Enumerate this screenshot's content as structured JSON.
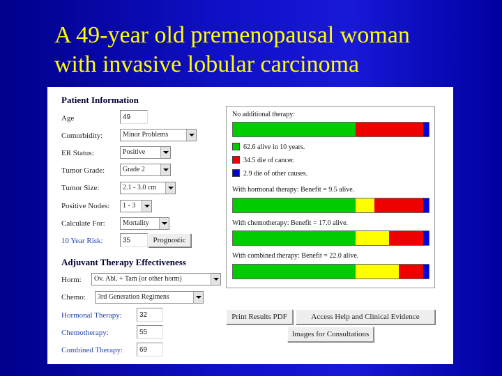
{
  "slide": {
    "title_line1": "A 49-year old premenopausal woman",
    "title_line2": "with invasive lobular carcinoma"
  },
  "colors": {
    "alive": "#00cc00",
    "cancer": "#ee0000",
    "other": "#0000dd",
    "benefit": "#ffff00"
  },
  "patient": {
    "heading": "Patient Information",
    "age_label": "Age",
    "age_value": "49",
    "comorbidity_label": "Comorbidity:",
    "comorbidity_value": "Minor Problems",
    "er_label": "ER Status:",
    "er_value": "Positive",
    "grade_label": "Tumor Grade:",
    "grade_value": "Grade 2",
    "size_label": "Tumor Size:",
    "size_value": "2.1 - 3.0 cm",
    "nodes_label": "Positive Nodes:",
    "nodes_value": "1 - 3",
    "calc_label": "Calculate For:",
    "calc_value": "Mortality",
    "risk_label": "10 Year Risk:",
    "risk_value": "35",
    "prognostic_button": "Prognostic"
  },
  "adjuvant": {
    "heading": "Adjuvant Therapy Effectiveness",
    "horm_label": "Horm:",
    "horm_value": "Ov. Abl. + Tam (or other horm)",
    "chemo_label": "Chemo:",
    "chemo_value": "3rd Generation Regimens",
    "hormonal_label": "Hormonal Therapy:",
    "hormonal_value": "32",
    "chemotherapy_label": "Chemotherapy:",
    "chemotherapy_value": "55",
    "combined_label": "Combined Therapy:",
    "combined_value": "69"
  },
  "results": {
    "no_therapy_label": "No additional therapy:",
    "legend_alive": "62.6 alive in 10 years.",
    "legend_cancer": "34.5 die of cancer.",
    "legend_other": "2.9 die of other causes.",
    "hormonal_label": "With hormonal therapy:  Benefit = 9.5 alive.",
    "chemo_label": "With chemotherapy:  Benefit = 17.0 alive.",
    "combined_label": "With combined therapy:  Benefit = 22.0 alive.",
    "bars": {
      "none": {
        "alive": 62.6,
        "benefit": 0,
        "cancer": 34.5,
        "other": 2.9
      },
      "hormonal": {
        "alive": 62.6,
        "benefit": 9.5,
        "cancer": 25.0,
        "other": 2.9
      },
      "chemo": {
        "alive": 62.6,
        "benefit": 17.0,
        "cancer": 17.5,
        "other": 2.9
      },
      "combined": {
        "alive": 62.6,
        "benefit": 22.0,
        "cancer": 12.5,
        "other": 2.9
      }
    }
  },
  "buttons": {
    "print_pdf": "Print Results PDF",
    "help": "Access Help and Clinical Evidence",
    "images": "Images for Consultations"
  }
}
